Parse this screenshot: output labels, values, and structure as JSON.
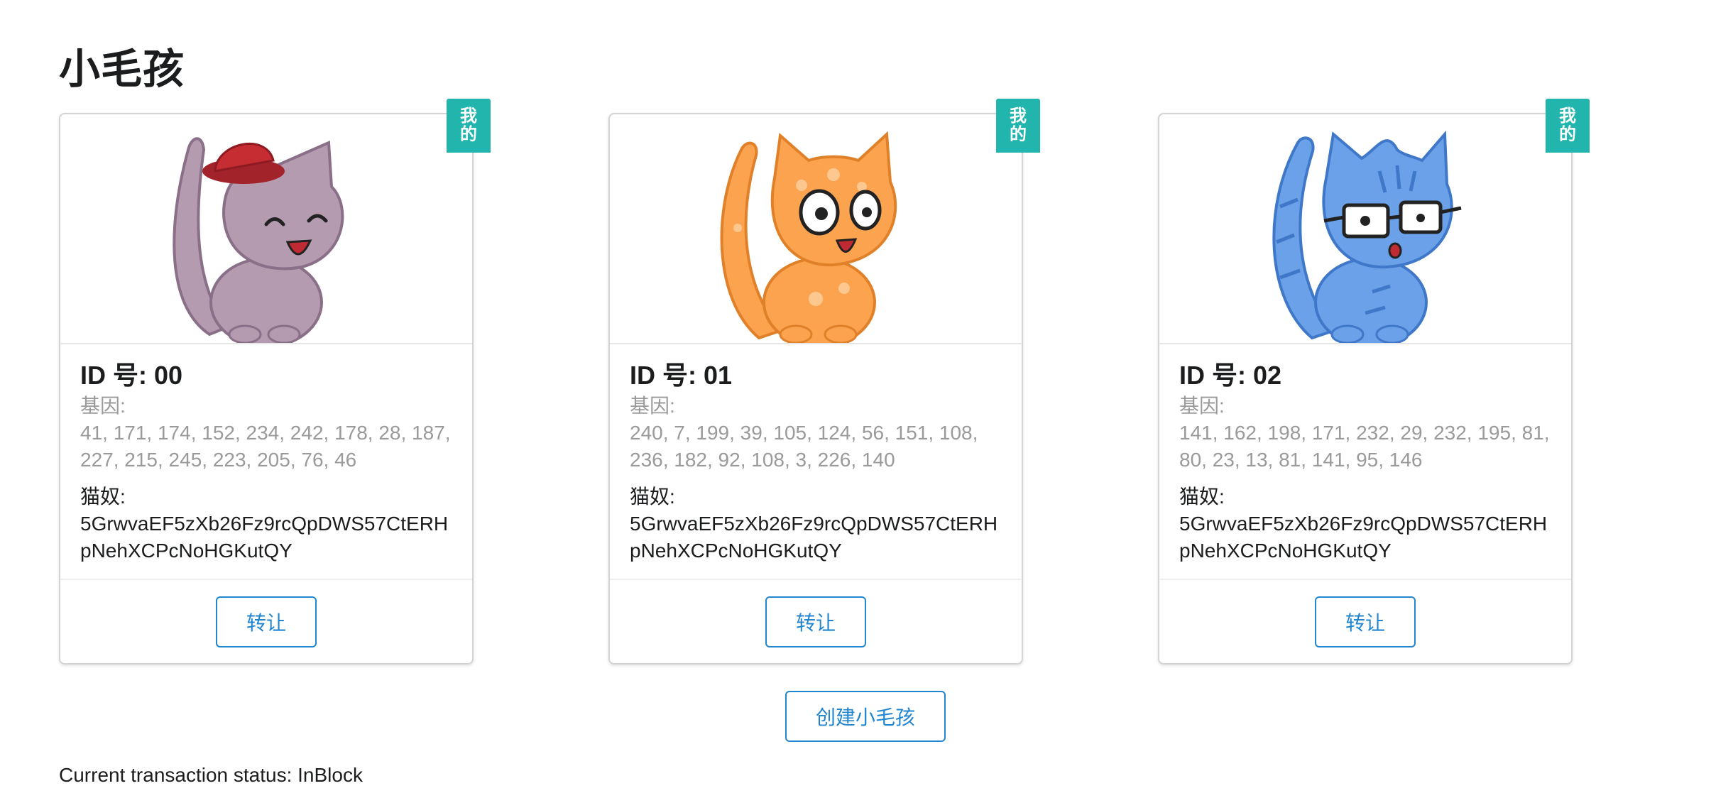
{
  "page": {
    "title": "小毛孩"
  },
  "colors": {
    "ribbon": "#21b5ad",
    "button_accent": "#2185d0",
    "gene_text": "#9a9a9a",
    "cat_purple": "#b49bb0",
    "cat_orange": "#fba34f",
    "cat_blue": "#6aa1e8",
    "hat_red": "#c62d33"
  },
  "kitties": [
    {
      "ribbon_label": "我的",
      "id_label": "ID 号: 00",
      "gene_label": "基因:",
      "genes": "41, 171, 174, 152, 234, 242, 178, 28, 187, 227, 215, 245, 223, 205, 76, 46",
      "owner_label": "猫奴:",
      "owner": "5GrwvaEF5zXb26Fz9rcQpDWS57CtERHpNehXCPcNoHGKutQY",
      "transfer_label": "转让",
      "image": "purple-cat-with-red-hat"
    },
    {
      "ribbon_label": "我的",
      "id_label": "ID 号: 01",
      "gene_label": "基因:",
      "genes": "240, 7, 199, 39, 105, 124, 56, 151, 108, 236, 182, 92, 108, 3, 226, 140",
      "owner_label": "猫奴:",
      "owner": "5GrwvaEF5zXb26Fz9rcQpDWS57CtERHpNehXCPcNoHGKutQY",
      "transfer_label": "转让",
      "image": "orange-spotted-cat"
    },
    {
      "ribbon_label": "我的",
      "id_label": "ID 号: 02",
      "gene_label": "基因:",
      "genes": "141, 162, 198, 171, 232, 29, 232, 195, 81, 80, 23, 13, 81, 141, 95, 146",
      "owner_label": "猫奴:",
      "owner": "5GrwvaEF5zXb26Fz9rcQpDWS57CtERHpNehXCPcNoHGKutQY",
      "transfer_label": "转让",
      "image": "blue-striped-cat-with-glasses"
    }
  ],
  "create_button": "创建小毛孩",
  "status": {
    "text": "Current transaction status: InBlock"
  }
}
